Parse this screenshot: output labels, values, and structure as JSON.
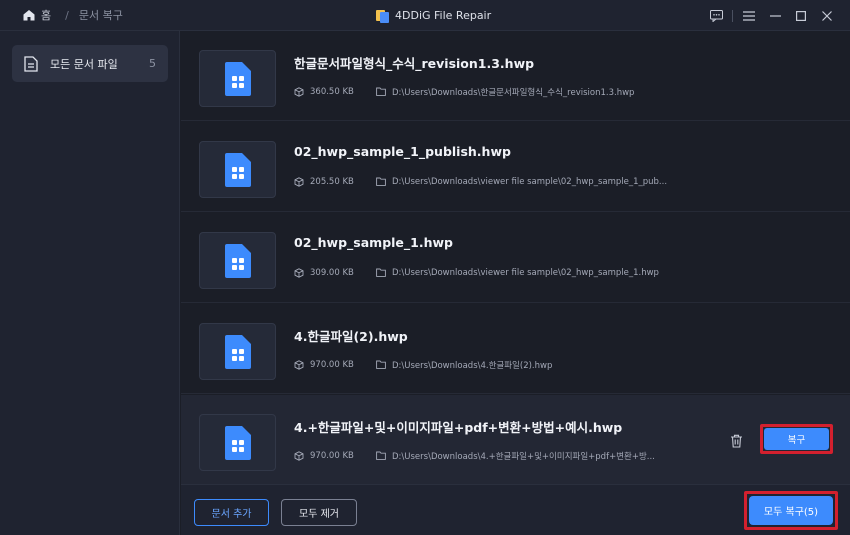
{
  "titlebar": {
    "home_label": "홈",
    "breadcrumb_current": "문서 복구",
    "app_title": "4DDiG File Repair"
  },
  "sidebar": {
    "items": [
      {
        "label": "모든 문서 파일",
        "count": "5"
      }
    ]
  },
  "files": [
    {
      "name": "한글문서파일형식_수식_revision1.3.hwp",
      "size": "360.50 KB",
      "path": "D:\\Users\\Downloads\\한글문서파일형식_수식_revision1.3.hwp"
    },
    {
      "name": "02_hwp_sample_1_publish.hwp",
      "size": "205.50 KB",
      "path": "D:\\Users\\Downloads\\viewer file sample\\02_hwp_sample_1_pub..."
    },
    {
      "name": "02_hwp_sample_1.hwp",
      "size": "309.00 KB",
      "path": "D:\\Users\\Downloads\\viewer file sample\\02_hwp_sample_1.hwp"
    },
    {
      "name": "4.한글파일(2).hwp",
      "size": "970.00 KB",
      "path": "D:\\Users\\Downloads\\4.한글파일(2).hwp"
    },
    {
      "name": "4.+한글파일+및+이미지파일+pdf+변환+방법+예시.hwp",
      "size": "970.00 KB",
      "path": "D:\\Users\\Downloads\\4.+한글파일+및+이미지파일+pdf+변환+방...",
      "recover_label": "복구"
    }
  ],
  "footer": {
    "add_label": "문서 추가",
    "clear_label": "모두 제거",
    "recover_all_label": "모두 복구(5)"
  },
  "colors": {
    "accent": "#3d8bfd",
    "highlight": "#d3202e",
    "background": "#1b1e27"
  }
}
